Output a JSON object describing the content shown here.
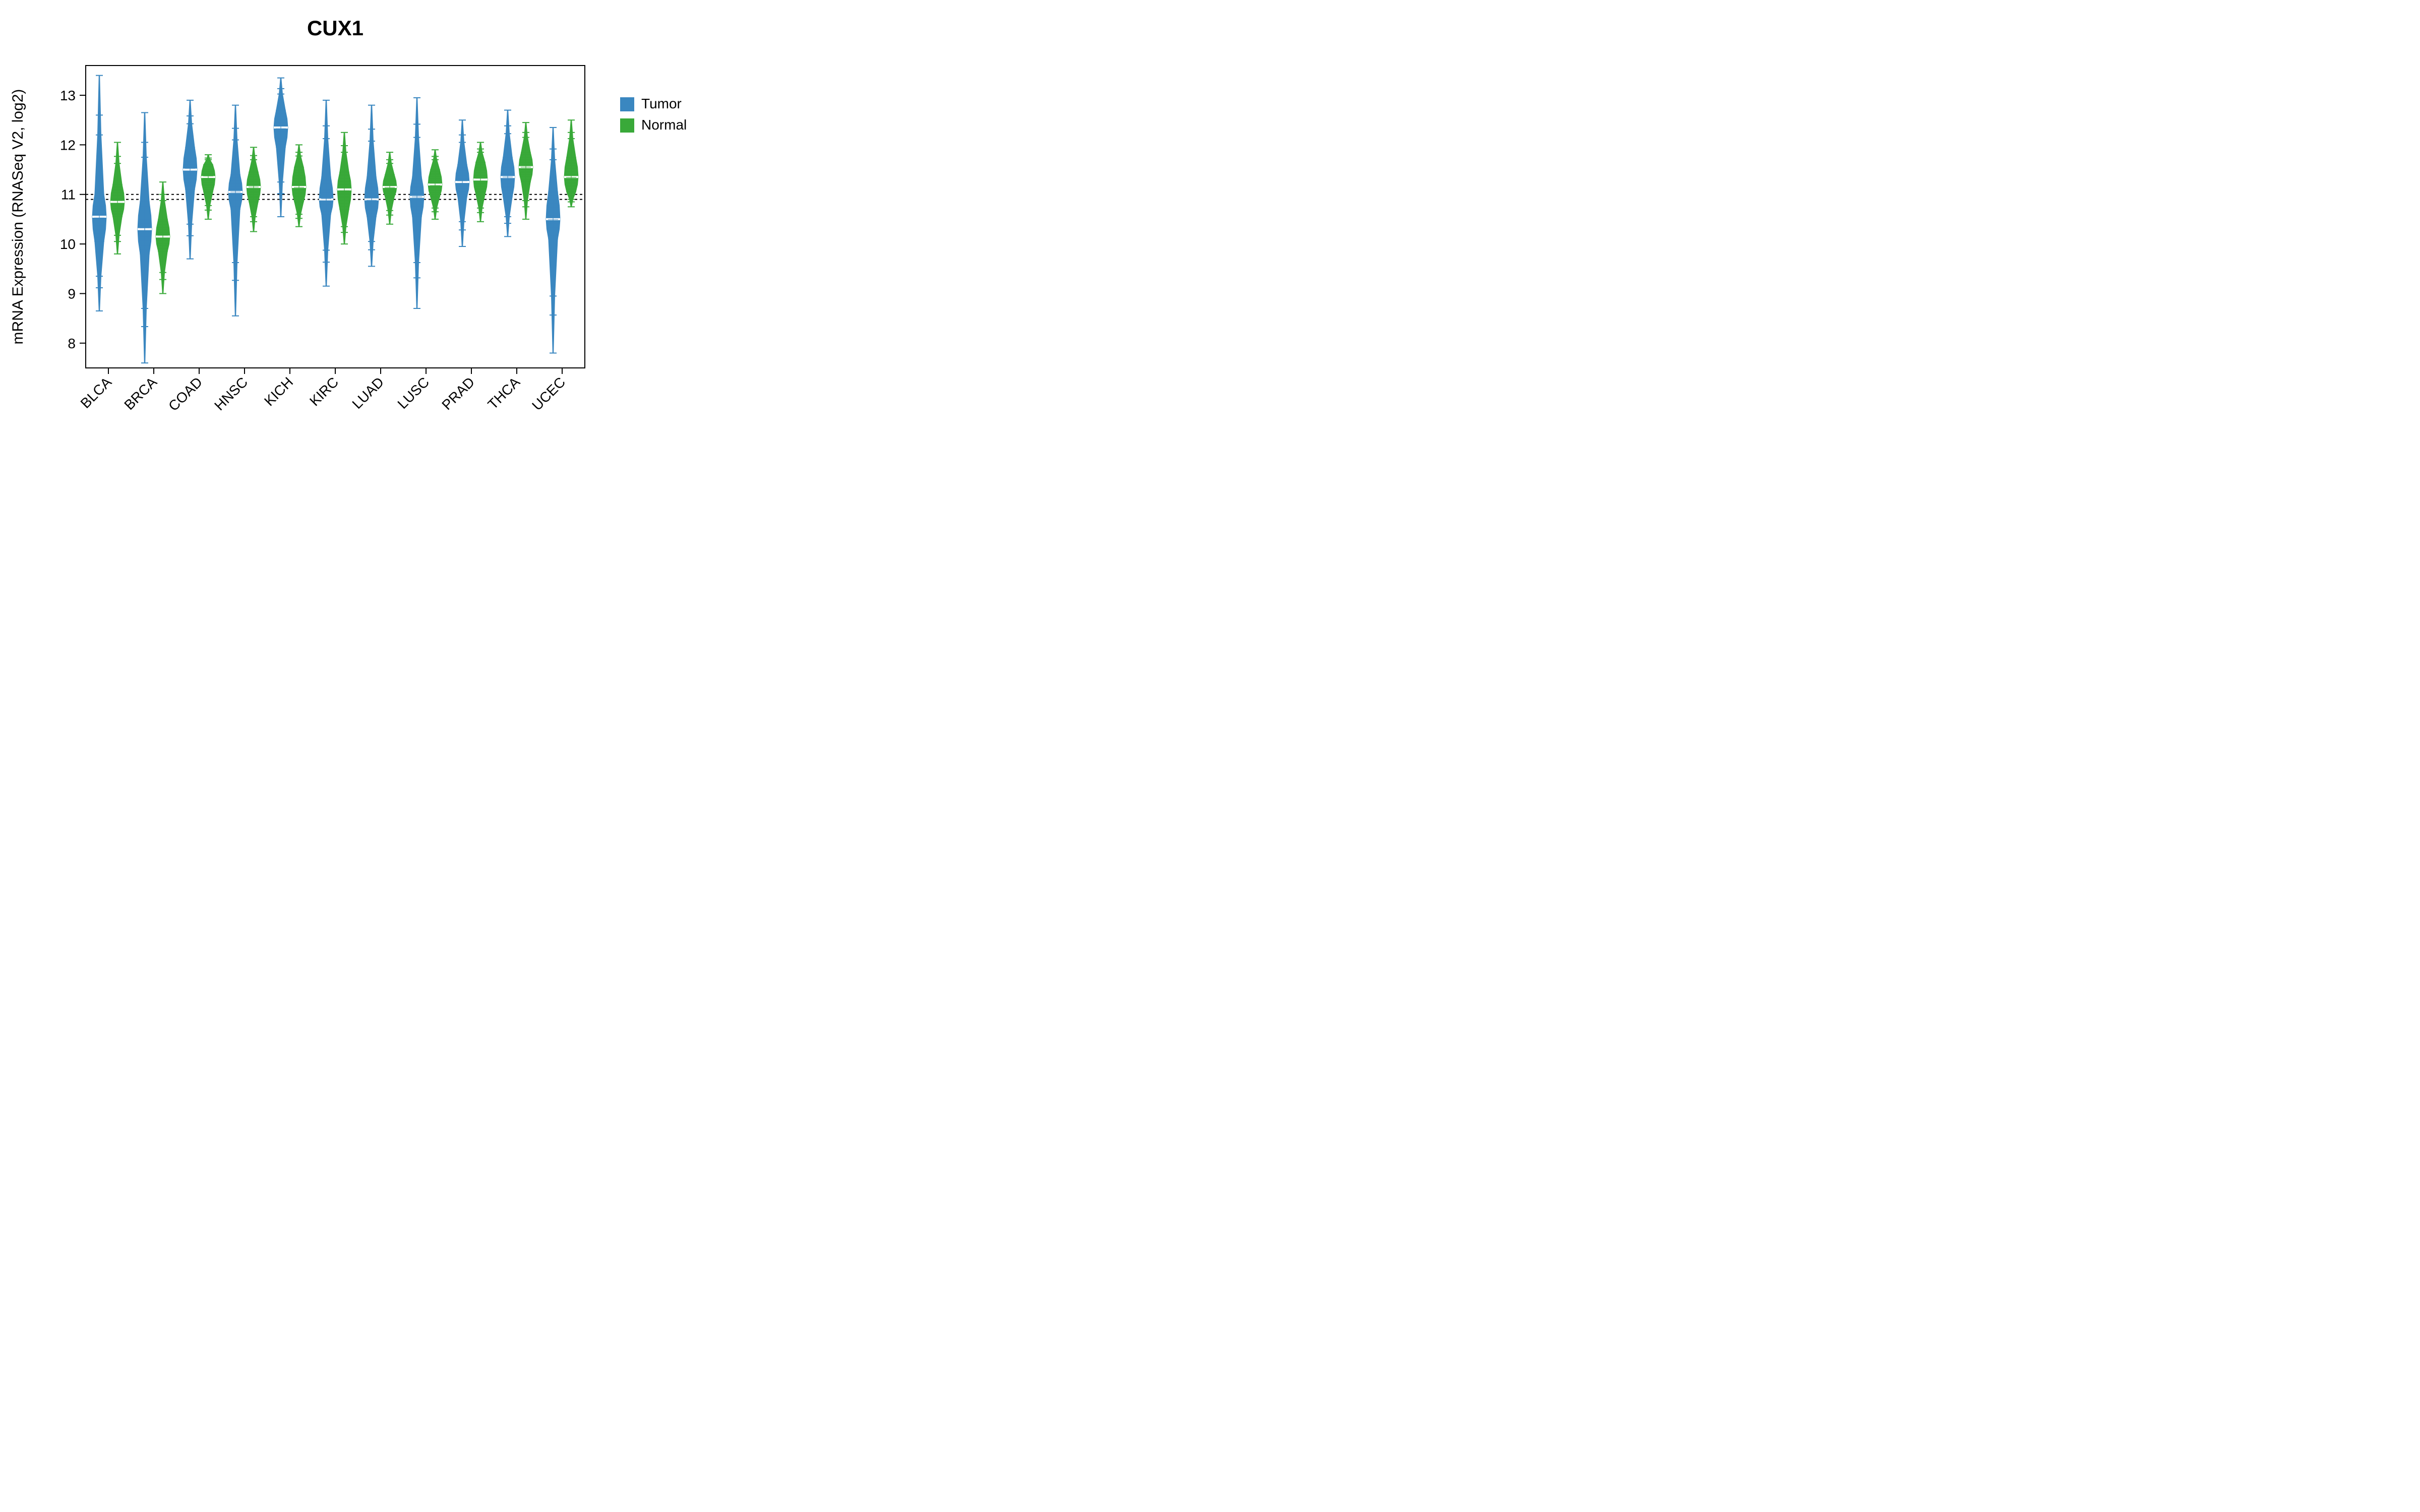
{
  "chart_data": {
    "type": "beanplot",
    "title": "CUX1",
    "ylabel": "mRNA Expression (RNASeq V2, log2)",
    "xlabel": "",
    "ylim": [
      7.5,
      13.6
    ],
    "yticks": [
      8,
      9,
      10,
      11,
      12,
      13
    ],
    "categories": [
      "BLCA",
      "BRCA",
      "COAD",
      "HNSC",
      "KICH",
      "KIRC",
      "LUAD",
      "LUSC",
      "PRAD",
      "THCA",
      "UCEC"
    ],
    "legend": [
      "Tumor",
      "Normal"
    ],
    "colors": {
      "Tumor": "#3a87c0",
      "Normal": "#39a939"
    },
    "reference_lines": [
      11.0,
      10.9
    ],
    "series": [
      {
        "name": "Tumor",
        "median": [
          10.55,
          10.3,
          11.5,
          11.05,
          12.35,
          10.9,
          10.9,
          10.95,
          11.25,
          11.35,
          10.5
        ],
        "q1": [
          10.05,
          9.8,
          11.1,
          10.7,
          11.95,
          10.6,
          10.55,
          10.55,
          10.95,
          10.95,
          10.1
        ],
        "q3": [
          11.0,
          10.85,
          11.95,
          11.4,
          12.7,
          11.35,
          11.35,
          11.35,
          11.6,
          11.75,
          11.05
        ],
        "min": [
          8.65,
          7.6,
          9.7,
          8.55,
          10.55,
          9.15,
          9.55,
          8.7,
          9.95,
          10.15,
          7.8
        ],
        "max": [
          13.4,
          12.65,
          12.9,
          12.8,
          13.35,
          12.9,
          12.8,
          12.95,
          12.5,
          12.7,
          12.35
        ]
      },
      {
        "name": "Normal",
        "median": [
          10.85,
          10.15,
          11.35,
          11.15,
          11.15,
          11.1,
          11.15,
          11.2,
          11.3,
          11.55,
          11.35
        ],
        "q1": [
          10.55,
          9.85,
          11.05,
          10.85,
          10.85,
          10.7,
          10.95,
          10.95,
          11.0,
          11.25,
          11.05
        ],
        "q3": [
          11.2,
          10.5,
          11.6,
          11.45,
          11.55,
          11.45,
          11.4,
          11.5,
          11.65,
          11.85,
          11.75
        ],
        "min": [
          9.8,
          9.0,
          10.5,
          10.25,
          10.35,
          10.0,
          10.4,
          10.5,
          10.45,
          10.5,
          10.75
        ],
        "max": [
          12.05,
          11.25,
          11.8,
          11.95,
          12.0,
          12.25,
          11.85,
          11.9,
          12.05,
          12.45,
          12.5
        ]
      }
    ]
  }
}
